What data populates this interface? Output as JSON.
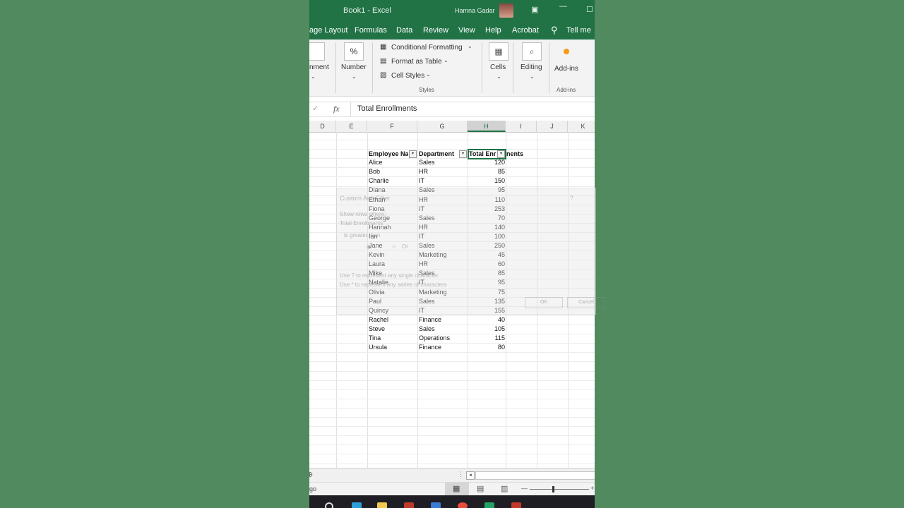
{
  "window": {
    "title": "Book1  -  Excel",
    "user": "Hamna Gadar"
  },
  "ribbon_tabs": [
    "age Layout",
    "Formulas",
    "Data",
    "Review",
    "View",
    "Help",
    "Acrobat",
    "Tell me"
  ],
  "ribbon": {
    "alignment_label": "nment",
    "number_label": "Number",
    "number_icon": "%",
    "conditional_formatting": "Conditional Formatting",
    "format_as_table": "Format as Table",
    "cell_styles": "Cell Styles",
    "styles_group": "Styles",
    "cells_label": "Cells",
    "editing_label": "Editing",
    "addins_label": "Add-ins",
    "addins_group": "Add-ins"
  },
  "formula_bar": {
    "value": "Total Enrollments"
  },
  "columns": [
    "D",
    "E",
    "F",
    "G",
    "H",
    "I",
    "J",
    "K"
  ],
  "table": {
    "headers": [
      "Employee Na",
      "Department",
      "Total Enr",
      "nents"
    ],
    "rows": [
      [
        "Alice",
        "Sales",
        "120"
      ],
      [
        "Bob",
        "HR",
        "85"
      ],
      [
        "Charlie",
        "IT",
        "150"
      ],
      [
        "Diana",
        "Sales",
        "95"
      ],
      [
        "Ethan",
        "HR",
        "110"
      ],
      [
        "Fiona",
        "IT",
        "253"
      ],
      [
        "George",
        "Sales",
        "70"
      ],
      [
        "Hannah",
        "HR",
        "140"
      ],
      [
        "Ian",
        "IT",
        "100"
      ],
      [
        "Jane",
        "Sales",
        "250"
      ],
      [
        "Kevin",
        "Marketing",
        "45"
      ],
      [
        "Laura",
        "HR",
        "60"
      ],
      [
        "Mike",
        "Sales",
        "85"
      ],
      [
        "Natalie",
        "IT",
        "95"
      ],
      [
        "Olivia",
        "Marketing",
        "75"
      ],
      [
        "Paul",
        "Sales",
        "135"
      ],
      [
        "Quincy",
        "IT",
        "155"
      ],
      [
        "Rachel",
        "Finance",
        "40"
      ],
      [
        "Steve",
        "Sales",
        "105"
      ],
      [
        "Tina",
        "Operations",
        "115"
      ],
      [
        "Ursula",
        "Finance",
        "80"
      ]
    ]
  },
  "ghost_dialog": {
    "title": "Custom AutoFilter",
    "show_rows": "Show rows where:",
    "field": "Total Enrollments",
    "condition": "is greater than",
    "or_label": "Or",
    "hint1": "Use ? to represent any single character",
    "hint2": "Use * to represent any series of characters",
    "ok": "OK",
    "cancel": "Cancel",
    "help": "?"
  },
  "status": {
    "left_text": "go"
  }
}
